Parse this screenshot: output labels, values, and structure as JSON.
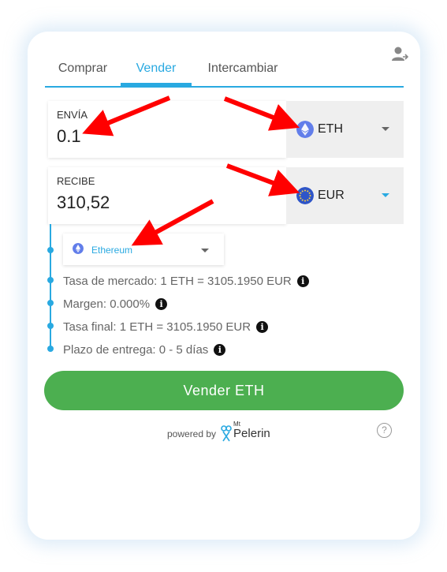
{
  "tabs": [
    {
      "label": "Comprar",
      "active": false
    },
    {
      "label": "Vender",
      "active": true
    },
    {
      "label": "Intercambiar",
      "active": false
    }
  ],
  "send": {
    "label": "ENVÍA",
    "value": "0.1",
    "currency": "ETH",
    "currency_icon": "ethereum-icon",
    "icon_color": "#627eea"
  },
  "receive": {
    "label": "RECIBE",
    "value": "310,52",
    "currency": "EUR",
    "currency_icon": "euro-flag-icon",
    "icon_color": "#2e55c8"
  },
  "network": {
    "label": "Ethereum",
    "icon": "ethereum-icon"
  },
  "info": [
    {
      "text": "Tasa de mercado: 1 ETH = 3105.1950 EUR"
    },
    {
      "text": "Margen: 0.000%"
    },
    {
      "text": "Tasa final: 1 ETH = 3105.1950 EUR"
    },
    {
      "text": "Plazo de entrega: 0 - 5 días"
    }
  ],
  "action_button": "Vender ETH",
  "footer": {
    "powered_by": "powered by",
    "brand_small": "Mt",
    "brand_name": "Pelerin"
  },
  "colors": {
    "accent": "#29a9e1",
    "button": "#4caf50",
    "annotation_arrow": "#ff0000"
  }
}
